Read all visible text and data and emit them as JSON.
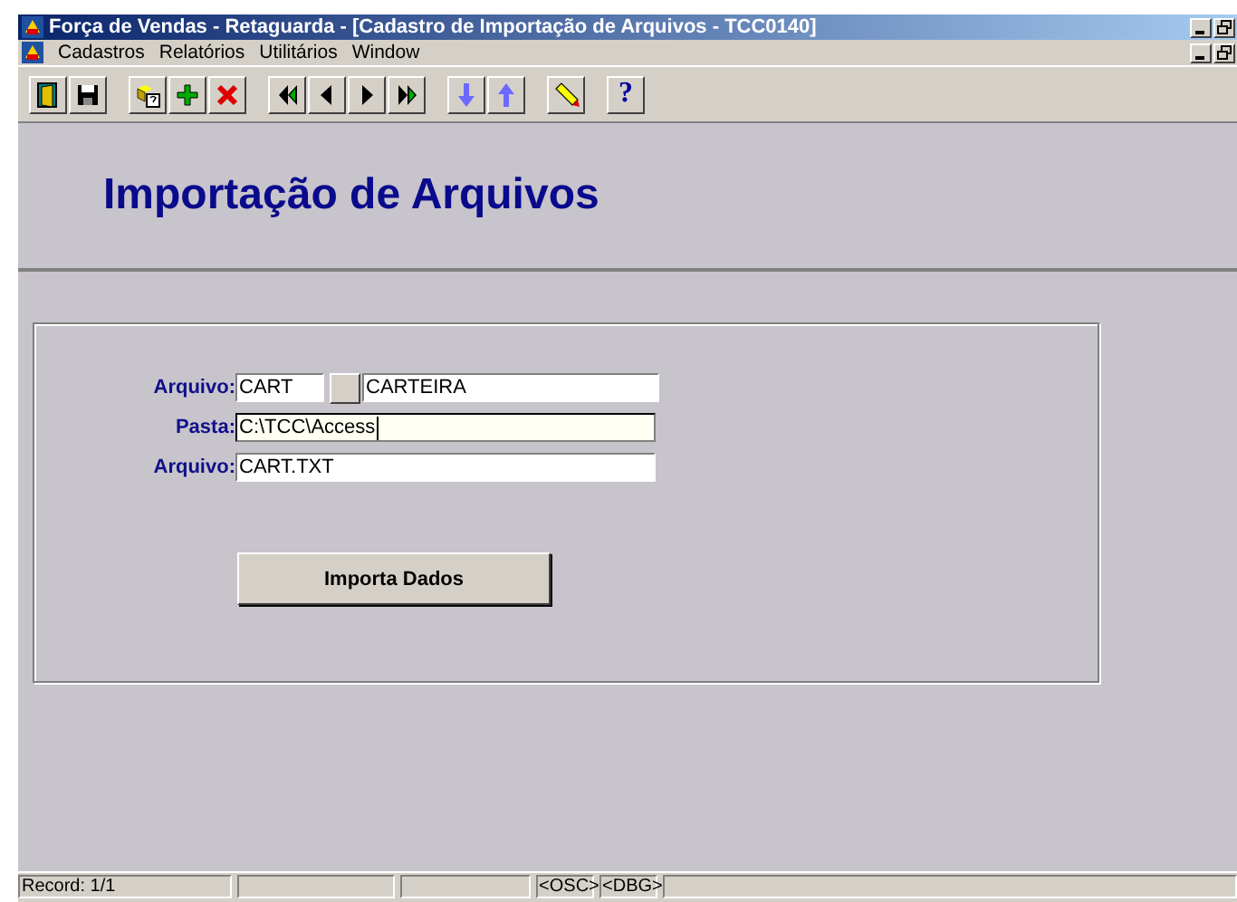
{
  "window": {
    "title": "Força de Vendas - Retaguarda - [Cadastro de Importação de Arquivos - TCC0140]"
  },
  "menu": [
    "Cadastros",
    "Relatórios",
    "Utilitários",
    "Window"
  ],
  "toolbar": [
    {
      "kind": "exit"
    },
    {
      "kind": "save"
    },
    {
      "kind": "gap"
    },
    {
      "kind": "query"
    },
    {
      "kind": "add"
    },
    {
      "kind": "delete"
    },
    {
      "kind": "gap"
    },
    {
      "kind": "first"
    },
    {
      "kind": "prev"
    },
    {
      "kind": "next"
    },
    {
      "kind": "last"
    },
    {
      "kind": "gap"
    },
    {
      "kind": "down"
    },
    {
      "kind": "up"
    },
    {
      "kind": "gap"
    },
    {
      "kind": "edit"
    },
    {
      "kind": "gap"
    },
    {
      "kind": "help",
      "text": "?"
    }
  ],
  "heading": "Importação de Arquivos",
  "form": {
    "rows": [
      {
        "label": "Arquivo:",
        "code": "CART",
        "description": "CARTEIRA"
      },
      {
        "label": "Pasta:",
        "value": "C:\\TCC\\Access",
        "focused": true
      },
      {
        "label": "Arquivo:",
        "value": "CART.TXT",
        "focused": false
      }
    ],
    "button": "Importa Dados"
  },
  "status_bar": {
    "record": "Record: 1/1",
    "indicators": [
      "<OSC>",
      "<DBG>"
    ]
  }
}
